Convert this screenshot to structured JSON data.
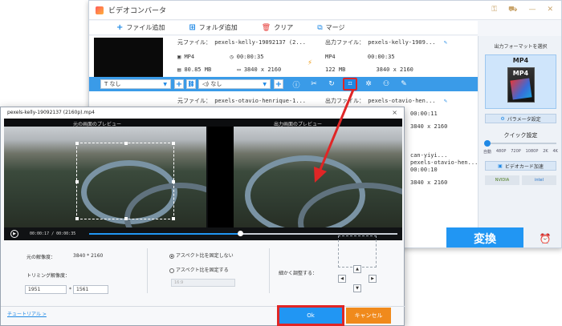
{
  "main_window": {
    "title": "ビデオコンバータ",
    "toolbar": {
      "add_file": "ファイル追加",
      "add_folder": "フォルダ追加",
      "clear": "クリア",
      "merge": "マージ"
    },
    "files": [
      {
        "source_label": "元ファイル：",
        "source_name": "pexels-kelly-19092137 (2...",
        "format": "MP4",
        "duration": "00:00:35",
        "size": "80.85 MB",
        "resolution": "3840 x 2160",
        "output_label": "出力ファイル：",
        "output_name": "pexels-kelly-1909...",
        "out_format": "MP4",
        "out_duration": "00:00:35",
        "out_size": "122 MB",
        "out_resolution": "3840 x 2160"
      },
      {
        "source_label": "元ファイル：",
        "source_name": "pexels-otavio-henrique-1...",
        "output_label": "出力ファイル：",
        "output_name": "pexels-otavio-hen...",
        "out_duration": "00:00:11",
        "out_resolution": "3840 x 2160"
      },
      {
        "output_name": "can-yiyi...",
        "output_name2": "pexels-otavio-hen...",
        "out_duration": "00:00:10",
        "out_resolution": "3840 x 2160"
      }
    ],
    "edit_bar": {
      "subtitle_select": "なし",
      "audio_select": "なし"
    },
    "side_panel": {
      "output_format_label": "出力フォーマットを選択",
      "format_name": "MP4",
      "format_icon_text": "MP4",
      "param_button": "パラメータ設定",
      "quick_setting": "クイック設定",
      "quick_labels": [
        "480P",
        "1080P",
        "4K",
        "自動",
        "720P",
        "2K"
      ],
      "quick_value": "自動",
      "gpu_button": "ビデオカード加速",
      "gpu_vendors": [
        "NVIDIA",
        "intel"
      ]
    },
    "convert_button": "変換"
  },
  "dialog": {
    "title": "pexels-kelly-19092137 (2160p).mp4",
    "close": "×",
    "original_preview_label": "元の画面のプレビュー",
    "output_preview_label": "出力画面のプレビュー",
    "current_time": "00:00:17",
    "total_time": "00:00:35",
    "time_separator": "/",
    "progress": 0.49,
    "original_resolution_label": "元の解像度：",
    "original_resolution_value": "3840 * 2160",
    "trim_resolution_label": "トリミング解像度：",
    "trim_width": "1951",
    "trim_height": "1561",
    "trim_times": "*",
    "aspect_free": "アスペクト比を固定しない",
    "aspect_fixed": "アスペクト比を固定する",
    "aspect_select": "16:9",
    "fine_adjust_label": "細かく調整する：",
    "tutorial_link": "チュートリアル >",
    "ok_button": "Ok",
    "cancel_button": "キャンセル"
  },
  "colors": {
    "accent_blue": "#2196f3",
    "highlight_red": "#e02626",
    "cancel_orange": "#f08a1c"
  }
}
